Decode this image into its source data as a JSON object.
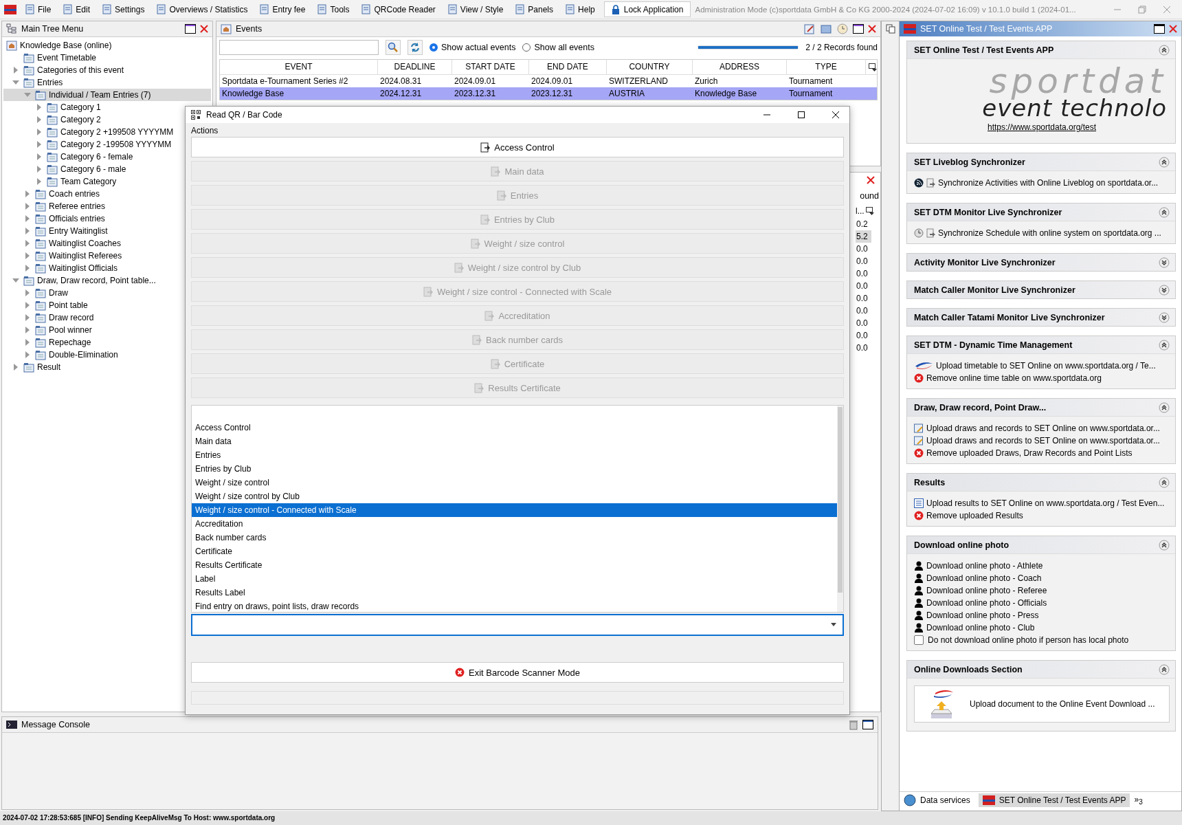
{
  "menubar": {
    "items": [
      {
        "label": "File"
      },
      {
        "label": "Edit"
      },
      {
        "label": "Settings"
      },
      {
        "label": "Overviews / Statistics"
      },
      {
        "label": "Entry fee"
      },
      {
        "label": "Tools"
      },
      {
        "label": "QRCode Reader"
      },
      {
        "label": "View / Style"
      },
      {
        "label": "Panels"
      },
      {
        "label": "Help"
      }
    ],
    "lock_button": "Lock Application",
    "info": "Administration Mode (c)sportdata GmbH & Co KG 2000-2024 (2024-07-02 16:09)  v 10.1.0 build 1 (2024-01..."
  },
  "tree_panel": {
    "title": "Main Tree Menu"
  },
  "tree": {
    "root": "Knowledge Base (online)",
    "items": [
      {
        "label": "Event Timetable",
        "selected": false
      },
      {
        "label": "Categories of this event",
        "expanded": false,
        "selected": false
      },
      {
        "label": "Entries",
        "expanded": true,
        "selected": false,
        "children": [
          {
            "label": "Individual / Team Entries (7)",
            "expanded": true,
            "selected": true,
            "children": [
              {
                "label": "Category 1",
                "expanded": false,
                "selected": false
              },
              {
                "label": "Category 2",
                "expanded": false,
                "selected": false
              },
              {
                "label": "Category 2 +199508 YYYYMM",
                "expanded": false,
                "selected": false
              },
              {
                "label": "Category 2 -199508 YYYYMM",
                "expanded": false,
                "selected": false
              },
              {
                "label": "Category 6 - female",
                "expanded": false,
                "selected": false
              },
              {
                "label": "Category 6 - male",
                "expanded": false,
                "selected": false
              },
              {
                "label": "Team Category",
                "expanded": false,
                "selected": false
              }
            ]
          },
          {
            "label": "Coach entries",
            "expanded": false,
            "selected": false
          },
          {
            "label": "Referee entries",
            "expanded": false,
            "selected": false
          },
          {
            "label": "Officials entries",
            "expanded": false,
            "selected": false
          },
          {
            "label": "Entry Waitinglist",
            "expanded": false,
            "selected": false
          },
          {
            "label": "Waitinglist Coaches",
            "expanded": false,
            "selected": false
          },
          {
            "label": "Waitinglist Referees",
            "expanded": false,
            "selected": false
          },
          {
            "label": "Waitinglist Officials",
            "expanded": false,
            "selected": false
          }
        ]
      },
      {
        "label": "Draw, Draw record, Point table...",
        "expanded": true,
        "selected": false,
        "children": [
          {
            "label": "Draw",
            "expanded": false,
            "selected": false
          },
          {
            "label": "Point table",
            "expanded": false,
            "selected": false
          },
          {
            "label": "Draw record",
            "expanded": false,
            "selected": false
          },
          {
            "label": "Pool winner",
            "expanded": false,
            "selected": false
          },
          {
            "label": "Repechage",
            "expanded": false,
            "selected": false
          },
          {
            "label": "Double-Elimination",
            "expanded": false,
            "selected": false
          }
        ]
      },
      {
        "label": "Result",
        "expanded": false,
        "selected": false
      }
    ]
  },
  "events_panel": {
    "title": "Events",
    "radios": [
      {
        "label": "Show actual events",
        "selected": true
      },
      {
        "label": "Show all events",
        "selected": false
      }
    ],
    "progress": {
      "level": 1
    },
    "records": "2 / 2 Records found"
  },
  "table": {
    "columns": [
      "EVENT",
      "DEADLINE",
      "START DATE",
      "END DATE",
      "COUNTRY",
      "ADDRESS",
      "TYPE"
    ],
    "rows": [
      {
        "cells": [
          "Sportdata e-Tournament Series #2",
          "2024.08.31",
          "2024.09.01",
          "2024.09.01",
          "SWITZERLAND",
          "Zurich",
          "Tournament"
        ],
        "selected": false
      },
      {
        "cells": [
          "Knowledge Base",
          "2024.12.31",
          "2023.12.31",
          "2023.12.31",
          "AUSTRIA",
          "Knowledge Base",
          "Tournament"
        ],
        "selected": true
      }
    ]
  },
  "second_panel": {
    "toolbar_fragment": "ound",
    "column_fragment": "l...",
    "values": [
      {
        "text": "0.2",
        "selected": false
      },
      {
        "text": "5.2",
        "selected": true
      },
      {
        "text": "0.0",
        "selected": false
      },
      {
        "text": "0.0",
        "selected": false
      },
      {
        "text": "0.0",
        "selected": false
      },
      {
        "text": "0.0",
        "selected": false
      },
      {
        "text": "0.0",
        "selected": false
      },
      {
        "text": "0.0",
        "selected": false
      },
      {
        "text": "0.0",
        "selected": false
      },
      {
        "text": "0.0",
        "selected": false
      },
      {
        "text": "0.0",
        "selected": false
      }
    ]
  },
  "dialog": {
    "title": "Read QR / Bar Code",
    "group": "Actions",
    "buttons": [
      {
        "label": "Access Control",
        "disabled": false
      },
      {
        "label": "Main data",
        "disabled": true
      },
      {
        "label": "Entries",
        "disabled": true
      },
      {
        "label": "Entries by Club",
        "disabled": true
      },
      {
        "label": "Weight / size control",
        "disabled": true
      },
      {
        "label": "Weight / size control by Club",
        "disabled": true
      },
      {
        "label": "Weight / size control - Connected with Scale",
        "disabled": true
      },
      {
        "label": "Accreditation",
        "disabled": true
      },
      {
        "label": "Back number cards",
        "disabled": true
      },
      {
        "label": "Certificate",
        "disabled": true
      },
      {
        "label": "Results Certificate",
        "disabled": true
      }
    ],
    "list": [
      {
        "label": "Access Control",
        "selected": false
      },
      {
        "label": "Main data",
        "selected": false
      },
      {
        "label": "Entries",
        "selected": false
      },
      {
        "label": "Entries by Club",
        "selected": false
      },
      {
        "label": "Weight / size control",
        "selected": false
      },
      {
        "label": "Weight / size control by Club",
        "selected": false
      },
      {
        "label": "Weight / size control - Connected with Scale",
        "selected": true
      },
      {
        "label": "Accreditation",
        "selected": false
      },
      {
        "label": "Back number cards",
        "selected": false
      },
      {
        "label": "Certificate",
        "selected": false
      },
      {
        "label": "Results Certificate",
        "selected": false
      },
      {
        "label": "Label",
        "selected": false
      },
      {
        "label": "Results Label",
        "selected": false
      },
      {
        "label": "Find entry on draws, point lists, draw records",
        "selected": false
      }
    ],
    "exit_button": "Exit Barcode Scanner Mode"
  },
  "console": {
    "title": "Message Console"
  },
  "right_panel": {
    "title": "SET Online Test / Test Events APP",
    "sections": [
      {
        "title": "SET Online Test / Test Events APP",
        "expanded": true,
        "items": [
          {
            "kind": "logo",
            "brand": "sportdat",
            "tagline": "event technolo"
          },
          {
            "kind": "link",
            "text": "https://www.sportdata.org/test"
          }
        ]
      },
      {
        "title": "SET Liveblog Synchronizer",
        "expanded": true,
        "items": [
          {
            "kind": "sync_blog",
            "text": "Synchronize Activities with Online Liveblog on sportdata.or..."
          }
        ]
      },
      {
        "title": "SET DTM Monitor Live Synchronizer",
        "expanded": true,
        "items": [
          {
            "kind": "sync_schedule",
            "text": "Synchronize Schedule with online system on sportdata.org ..."
          }
        ]
      },
      {
        "title": "Activity Monitor Live Synchronizer",
        "expanded": false
      },
      {
        "title": "Match Caller Monitor Live Synchronizer",
        "expanded": false
      },
      {
        "title": "Match Caller Tatami Monitor Live Synchronizer",
        "expanded": false
      },
      {
        "title": "SET DTM - Dynamic Time Management",
        "expanded": true,
        "items": [
          {
            "kind": "upload_timetable",
            "text": "Upload timetable to SET Online on www.sportdata.org / Te..."
          },
          {
            "kind": "remove",
            "text": "Remove online time table on www.sportdata.org"
          }
        ]
      },
      {
        "title": "Draw, Draw record, Point Draw...",
        "expanded": true,
        "items": [
          {
            "kind": "upload_draw",
            "text": "Upload draws and records to SET Online on www.sportdata.or..."
          },
          {
            "kind": "upload_draw",
            "text": "Upload draws and records to SET Online on www.sportdata.or..."
          },
          {
            "kind": "remove",
            "text": "Remove uploaded Draws, Draw Records and Point Lists"
          }
        ]
      },
      {
        "title": "Results",
        "expanded": true,
        "items": [
          {
            "kind": "upload_results",
            "text": "Upload results to SET Online on www.sportdata.org / Test Even..."
          },
          {
            "kind": "remove",
            "text": "Remove uploaded Results"
          }
        ]
      },
      {
        "title": "Download online photo",
        "expanded": true,
        "items": [
          {
            "kind": "person",
            "text": "Download online photo - Athlete"
          },
          {
            "kind": "person",
            "text": "Download online photo - Coach"
          },
          {
            "kind": "person",
            "text": "Download online photo - Referee"
          },
          {
            "kind": "person",
            "text": "Download online photo - Officials"
          },
          {
            "kind": "person",
            "text": "Download online photo - Press"
          },
          {
            "kind": "person",
            "text": "Download online photo - Club"
          },
          {
            "kind": "checkbox",
            "checked": false,
            "text": "Do not download online photo if person has local photo"
          }
        ]
      },
      {
        "title": "Online Downloads Section",
        "expanded": true,
        "items": [
          {
            "kind": "upload_card",
            "text": "Upload document to the Online Event Download ..."
          }
        ]
      }
    ],
    "tabs": [
      {
        "label": "Data services",
        "selected": false
      },
      {
        "label": "SET Online Test / Test Events APP",
        "selected": true
      }
    ],
    "overflow": {
      "glyph": "»",
      "count": "3"
    }
  },
  "status_bar": "2024-07-02 17:28:53:685 [INFO] Sending KeepAliveMsg To Host: www.sportdata.org"
}
